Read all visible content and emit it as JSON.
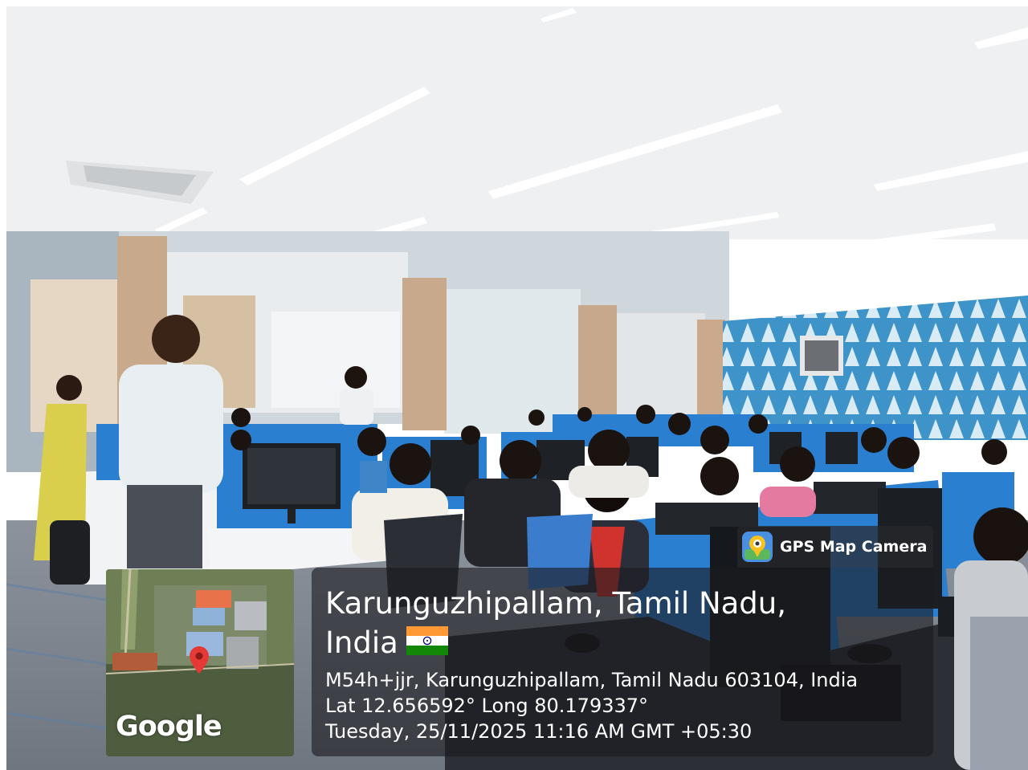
{
  "app": {
    "name": "GPS Map Camera",
    "icon": "map-pin-camera-icon"
  },
  "location": {
    "place_line_1": "Karunguzhipallam, Tamil Nadu,",
    "place_line_2": "India",
    "flag_icon": "india-flag-icon",
    "address": "M54h+jjr, Karunguzhipallam, Tamil Nadu 603104, India",
    "coordinates": "Lat 12.656592° Long 80.179337°",
    "datetime": "Tuesday, 25/11/2025 11:16 AM GMT +05:30"
  },
  "map": {
    "provider_logo": "Google",
    "pin_icon": "map-pin-icon"
  },
  "colors": {
    "overlay": "#1c1c20",
    "desk_blue": "#2a7fd1",
    "wall_pattern": "#3e93c8",
    "pin_red": "#e53935"
  }
}
